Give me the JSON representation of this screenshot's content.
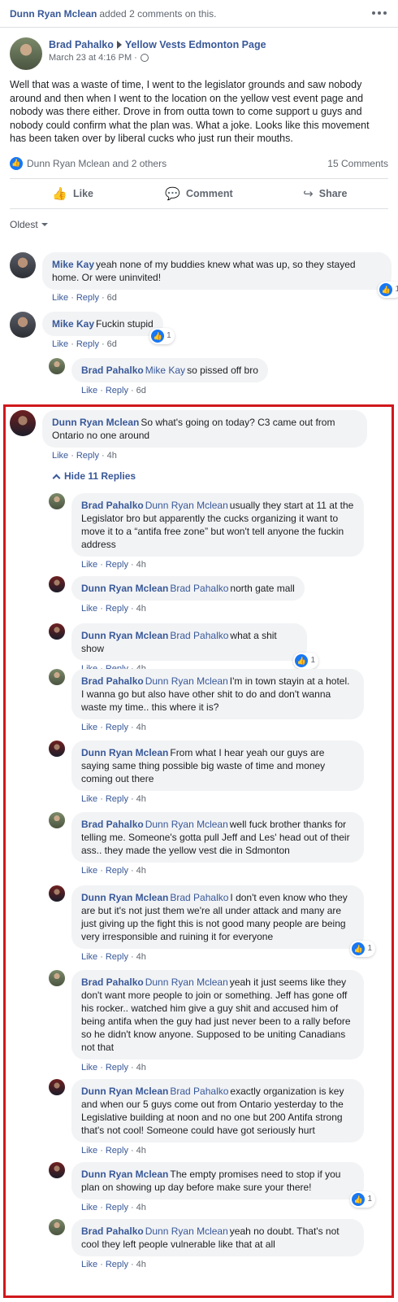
{
  "top_bar": {
    "actor": "Dunn Ryan Mclean",
    "action": "added 2 comments on this."
  },
  "post": {
    "author": "Brad Pahalko",
    "target": "Yellow Vests Edmonton Page",
    "time": "March 23 at 4:16 PM ·",
    "text": "Well that was a waste of time, I went to the legislator grounds and saw nobody around and then when I went to the location on the yellow vest event page and nobody was there either. Drove in from outta town to come support u guys and nobody could confirm what the plan was. What a joke. Looks like this movement has been taken over by liberal cucks who just run their mouths.",
    "reactions_text": "Dunn Ryan Mclean and 2 others",
    "comments_count": "15 Comments"
  },
  "actions": {
    "like": "Like",
    "comment": "Comment",
    "share": "Share"
  },
  "order_label": "Oldest",
  "meta_labels": {
    "like": "Like",
    "reply": "Reply",
    "dot": "·"
  },
  "hide_replies": "Hide 11 Replies",
  "comments": [
    {
      "name": "Mike Kay",
      "mention": "",
      "text": "yeah none of my buddies knew what was up, so they stayed home. Or were uninvited!",
      "time": "6d",
      "likes": "1"
    },
    {
      "name": "Mike Kay",
      "mention": "",
      "text": "Fuckin stupid",
      "time": "6d",
      "likes": "1"
    },
    {
      "name": "Brad Pahalko",
      "mention": "Mike Kay",
      "text": "so pissed off bro",
      "time": "6d",
      "likes": ""
    },
    {
      "name": "Dunn Ryan Mclean",
      "mention": "",
      "text": "So what's going on today? C3 came out from Ontario no one around",
      "time": "4h",
      "likes": ""
    },
    {
      "name": "Brad Pahalko",
      "mention": "Dunn Ryan Mclean",
      "text": "usually they start at 11 at the Legislator bro but apparently the cucks organizing it want to move it to a “antifa free zone” but won't tell anyone the fuckin address",
      "time": "4h",
      "likes": ""
    },
    {
      "name": "Dunn Ryan Mclean",
      "mention": "Brad Pahalko",
      "text": "north gate mall",
      "time": "4h",
      "likes": ""
    },
    {
      "name": "Dunn Ryan Mclean",
      "mention": "Brad Pahalko",
      "text": "what a shit show",
      "time": "4h",
      "likes": "1"
    },
    {
      "name": "Brad Pahalko",
      "mention": "Dunn Ryan Mclean",
      "text": "I'm in town stayin at a hotel. I wanna go but also have other shit to do and don't wanna waste my time.. this where it is?",
      "time": "4h",
      "likes": ""
    },
    {
      "name": "Dunn Ryan Mclean",
      "mention": "",
      "text": "From what I hear yeah our guys are saying same thing possible big waste of time and money coming out there",
      "time": "4h",
      "likes": ""
    },
    {
      "name": "Brad Pahalko",
      "mention": "Dunn Ryan Mclean",
      "text": "well fuck brother thanks for telling me. Someone's gotta pull Jeff and Les' head out of their ass.. they made the yellow vest die in Sdmonton",
      "time": "4h",
      "likes": ""
    },
    {
      "name": "Dunn Ryan Mclean",
      "mention": "Brad Pahalko",
      "text": "I don't even know who they are but it's not just them we're all under attack and many are just giving up the fight this is not good many people are being very irresponsible and ruining it for everyone",
      "time": "4h",
      "likes": "1"
    },
    {
      "name": "Brad Pahalko",
      "mention": "Dunn Ryan Mclean",
      "text": "yeah it just seems like they don't want more people to join or something. Jeff has gone off his rocker.. watched him give a guy shit and accused him of being antifa when the guy had just never been to a rally before so he didn't know anyone. Supposed to be uniting Canadians not that",
      "time": "4h",
      "likes": ""
    },
    {
      "name": "Dunn Ryan Mclean",
      "mention": "Brad Pahalko",
      "text": "exactly organization is key and when our 5 guys come out from Ontario yesterday to the Legislative building at noon and no one but 200 Antifa strong that's not cool! Someone could have got seriously hurt",
      "time": "4h",
      "likes": ""
    },
    {
      "name": "Dunn Ryan Mclean",
      "mention": "",
      "text": "The empty promises need to stop if you plan on showing up day before make sure your there!",
      "time": "4h",
      "likes": "1"
    },
    {
      "name": "Brad Pahalko",
      "mention": "Dunn Ryan Mclean",
      "text": "yeah no doubt. That's not cool they left people vulnerable like that at all",
      "time": "4h",
      "likes": ""
    }
  ]
}
